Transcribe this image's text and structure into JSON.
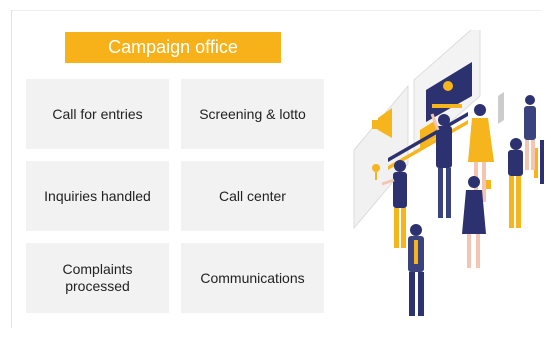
{
  "header": {
    "title": "Campaign office"
  },
  "cells": [
    {
      "label": "Call for entries"
    },
    {
      "label": "Screening & lotto"
    },
    {
      "label": "Inquiries handled"
    },
    {
      "label": "Call center"
    },
    {
      "label": "Complaints\nprocessed"
    },
    {
      "label": "Communications"
    }
  ],
  "colors": {
    "accent": "#f7b21a",
    "cell_background": "#f2f2f2",
    "figure_navy": "#2c3170",
    "figure_yellow": "#f6b51c"
  },
  "illustration": {
    "icon": "team-with-ui-screens-illustration"
  }
}
